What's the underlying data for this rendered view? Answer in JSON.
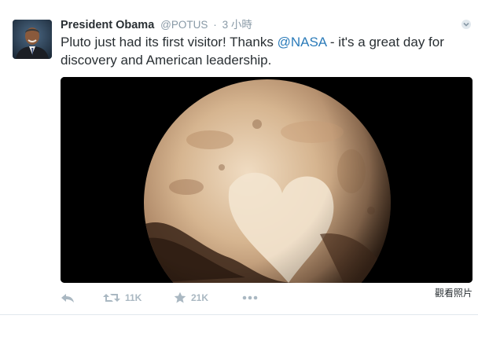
{
  "tweet": {
    "author_name": "President Obama",
    "handle": "@POTUS",
    "separator": "·",
    "time": "3 小時",
    "text_before": "Pluto just had its first visitor! Thanks ",
    "mention": "@NASA",
    "text_after": " - it's a great day for discovery and American leadership.",
    "retweet_count": "11K",
    "favorite_count": "21K",
    "view_photo_label": "觀看照片"
  },
  "icons": {
    "reply": "reply-icon",
    "retweet": "retweet-icon",
    "favorite": "star-icon",
    "more": "more-icon",
    "caret": "chevron-down-icon"
  },
  "colors": {
    "link": "#2b7bb9",
    "muted": "#8899a6",
    "action": "#aab8c2",
    "text": "#292f33"
  }
}
